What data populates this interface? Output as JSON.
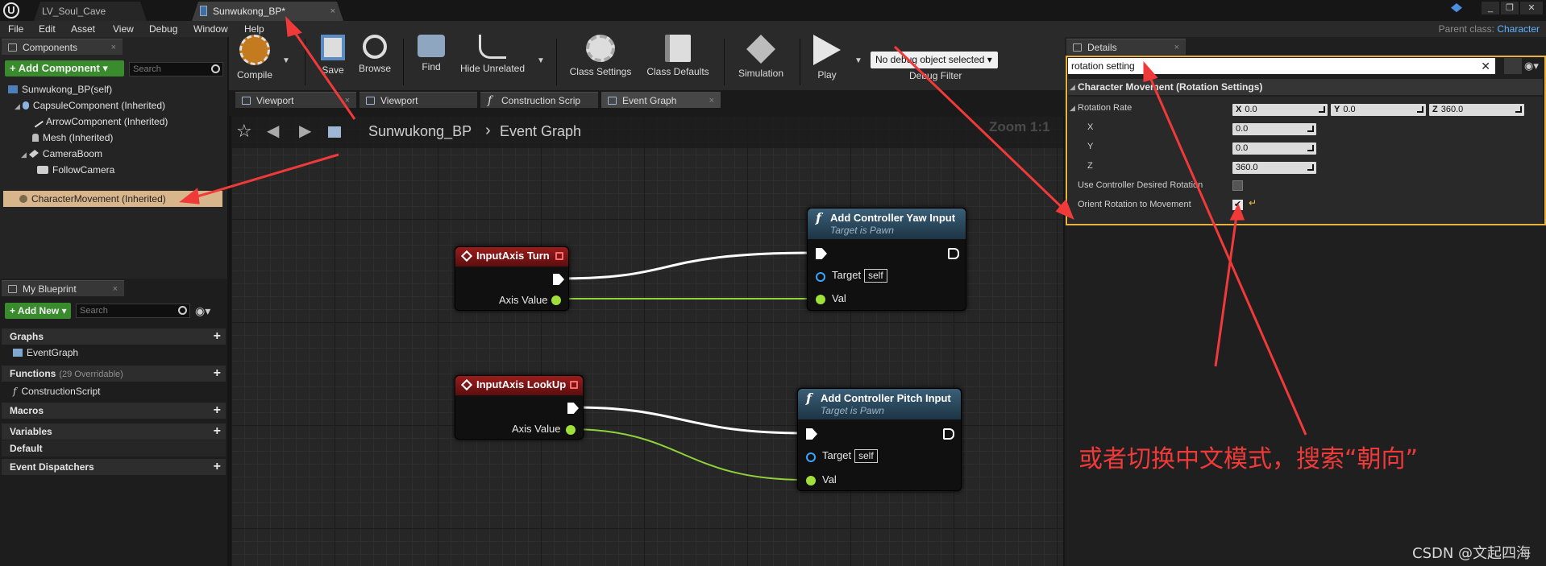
{
  "title_bar": {
    "tabs": [
      {
        "label": "LV_Soul_Cave"
      },
      {
        "label": "Sunwukong_BP*"
      }
    ],
    "close_glyph": "×"
  },
  "menu": {
    "items": [
      "File",
      "Edit",
      "Asset",
      "View",
      "Debug",
      "Window",
      "Help"
    ],
    "parent_class_label": "Parent class:",
    "parent_class_value": "Character"
  },
  "components_panel": {
    "tab_label": "Components",
    "add_button": "+ Add Component ▾",
    "search_placeholder": "Search",
    "tree": [
      {
        "label": "Sunwukong_BP(self)",
        "icon": "blueprint-icon"
      },
      {
        "label": "CapsuleComponent (Inherited)",
        "icon": "capsule-icon"
      },
      {
        "label": "ArrowComponent (Inherited)",
        "icon": "arrow-icon"
      },
      {
        "label": "Mesh (Inherited)",
        "icon": "mesh-icon"
      },
      {
        "label": "CameraBoom",
        "icon": "spring-arm-icon"
      },
      {
        "label": "FollowCamera",
        "icon": "camera-icon"
      },
      {
        "label": "CharacterMovement (Inherited)",
        "icon": "movement-icon"
      }
    ]
  },
  "my_blueprint": {
    "tab_label": "My Blueprint",
    "add_new": "+ Add New ▾",
    "search_placeholder": "Search",
    "sections": {
      "graphs": "Graphs",
      "event_graph": "EventGraph",
      "functions": "Functions",
      "functions_sub": "(29 Overridable)",
      "construction_script": "ConstructionScript",
      "macros": "Macros",
      "variables": "Variables",
      "default": "Default",
      "event_dispatchers": "Event Dispatchers"
    }
  },
  "toolbar": {
    "compile": "Compile",
    "save": "Save",
    "browse": "Browse",
    "find": "Find",
    "hide_unrelated": "Hide Unrelated",
    "class_settings": "Class Settings",
    "class_defaults": "Class Defaults",
    "simulation": "Simulation",
    "play": "Play",
    "debug_object": "No debug object selected ▾",
    "debug_filter": "Debug Filter"
  },
  "editor_tabs": [
    "Viewport",
    "Viewport",
    "Construction Scrip",
    "Event Graph"
  ],
  "graph": {
    "breadcrumb_root": "Sunwukong_BP",
    "breadcrumb_sep": "›",
    "breadcrumb_leaf": "Event Graph",
    "zoom": "Zoom 1:1",
    "nodes": {
      "turn_title": "InputAxis Turn",
      "turn_axis": "Axis Value",
      "lookup_title": "InputAxis LookUp",
      "lookup_axis": "Axis Value",
      "yaw_title": "Add Controller Yaw Input",
      "yaw_sub": "Target is Pawn",
      "yaw_target": "Target",
      "yaw_self": "self",
      "yaw_val": "Val",
      "pitch_title": "Add Controller Pitch Input",
      "pitch_sub": "Target is Pawn",
      "pitch_target": "Target",
      "pitch_self": "self",
      "pitch_val": "Val"
    }
  },
  "details": {
    "tab_label": "Details",
    "search_value": "rotation setting",
    "category": "Character Movement (Rotation Settings)",
    "rotation_rate_label": "Rotation Rate",
    "rotation_rate": {
      "x_lbl": "X",
      "x": "0.0",
      "y_lbl": "Y",
      "y": "0.0",
      "z_lbl": "Z",
      "z": "360.0"
    },
    "x_label": "X",
    "x_value": "0.0",
    "y_label": "Y",
    "y_value": "0.0",
    "z_label": "Z",
    "z_value": "360.0",
    "use_controller_label": "Use Controller Desired Rotation",
    "use_controller_checked": false,
    "orient_label": "Orient Rotation to Movement",
    "orient_checked": true
  },
  "annotation": "或者切换中文模式，搜索“朝向”",
  "watermark": "CSDN @文起四海",
  "colors": {
    "annotation_red": "#f03a3a",
    "accent_green": "#3a8a2e",
    "highlight_orange": "#e8b23c",
    "event_red": "#9a1c1c",
    "function_blue": "#3a5f78",
    "float_pin": "#9fe03a",
    "object_pin": "#38a5ff"
  }
}
